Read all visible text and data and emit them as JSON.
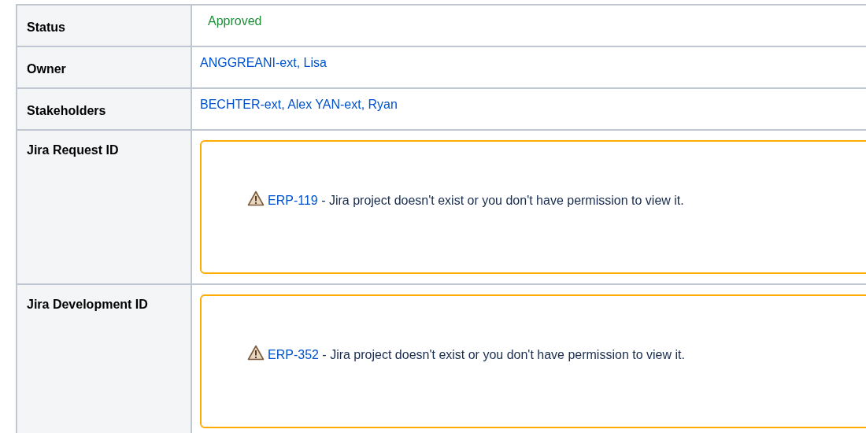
{
  "rows": [
    {
      "label": "Status",
      "kind": "status",
      "value": "Approved"
    },
    {
      "label": "Owner",
      "kind": "people",
      "people": [
        "ANGGREANI-ext, Lisa"
      ]
    },
    {
      "label": "Stakeholders",
      "kind": "people",
      "people": [
        "BECHTER-ext, Alex",
        "YAN-ext, Ryan"
      ]
    },
    {
      "label": "Jira Request ID",
      "kind": "jira",
      "issue": "ERP-119",
      "message": " - Jira project doesn't exist or you don't have permission to view it."
    },
    {
      "label": "Jira Development ID",
      "kind": "jira",
      "issue": "ERP-352",
      "message": " - Jira project doesn't exist or you don't have permission to view it."
    }
  ]
}
